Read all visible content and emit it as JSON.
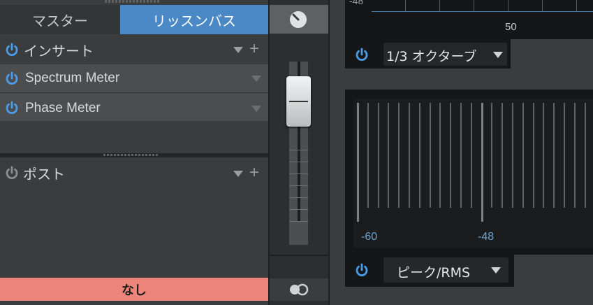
{
  "tabs": {
    "master": "マスター",
    "listen_bus": "リッスンバス"
  },
  "insert": {
    "title": "インサート",
    "slots": [
      {
        "label": "Spectrum Meter"
      },
      {
        "label": "Phase Meter"
      }
    ]
  },
  "post": {
    "title": "ポスト"
  },
  "routing": {
    "none_label": "なし"
  },
  "spectrum": {
    "top_axis_value": "-48",
    "axis_label": "50",
    "resolution": "1/3 オクターブ"
  },
  "level_meter": {
    "axis": [
      "-60",
      "-48"
    ],
    "mode": "ピーク/RMS"
  },
  "colors": {
    "accent": "#4a89c6",
    "power_on": "#4a9be8",
    "none_bar": "#ee857a"
  }
}
